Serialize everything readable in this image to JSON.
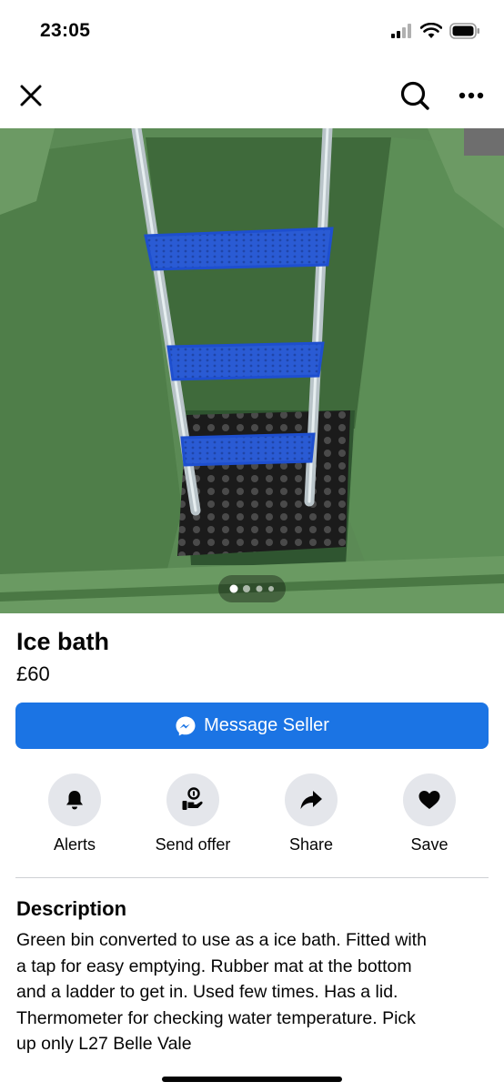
{
  "status_bar": {
    "time": "23:05"
  },
  "top_bar": {
    "close_icon": "close-icon",
    "search_icon": "search-icon",
    "more_icon": "more-icon"
  },
  "photo": {
    "carousel_pages": 4,
    "carousel_active": 1
  },
  "listing": {
    "title": "Ice bath",
    "price": "£60"
  },
  "message_button": {
    "label": "Message Seller",
    "icon": "messenger-icon",
    "color": "#1b74e4"
  },
  "actions": [
    {
      "label": "Alerts",
      "icon": "bell-icon"
    },
    {
      "label": "Send offer",
      "icon": "offer-icon"
    },
    {
      "label": "Share",
      "icon": "share-icon"
    },
    {
      "label": "Save",
      "icon": "heart-icon"
    }
  ],
  "description": {
    "heading": "Description",
    "lines": [
      "Green bin converted to use as a ice bath. Fitted with",
      "a tap for easy emptying. Rubber mat at the bottom",
      "and a ladder to get in. Used few times. Has a lid.",
      "Thermometer for checking water temperature. Pick",
      "up only L27 Belle Vale"
    ]
  }
}
